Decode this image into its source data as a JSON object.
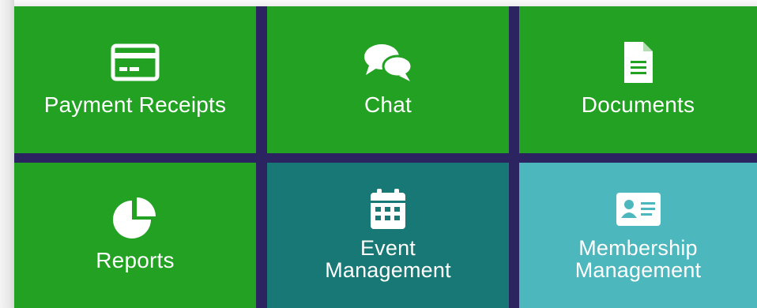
{
  "tiles": [
    {
      "label": "Payment Receipts",
      "icon": "credit-card-icon",
      "color": "#22a122"
    },
    {
      "label": "Chat",
      "icon": "chat-bubbles-icon",
      "color": "#22a122"
    },
    {
      "label": "Documents",
      "icon": "document-icon",
      "color": "#22a122"
    },
    {
      "label": "Reports",
      "icon": "pie-chart-icon",
      "color": "#22a122"
    },
    {
      "label": "Event\nManagement",
      "icon": "calendar-icon",
      "color": "#187875"
    },
    {
      "label": "Membership\nManagement",
      "icon": "id-card-icon",
      "color": "#4cb7bd"
    }
  ],
  "colors": {
    "divider": "#2b2460",
    "tile_text": "#ffffff"
  }
}
